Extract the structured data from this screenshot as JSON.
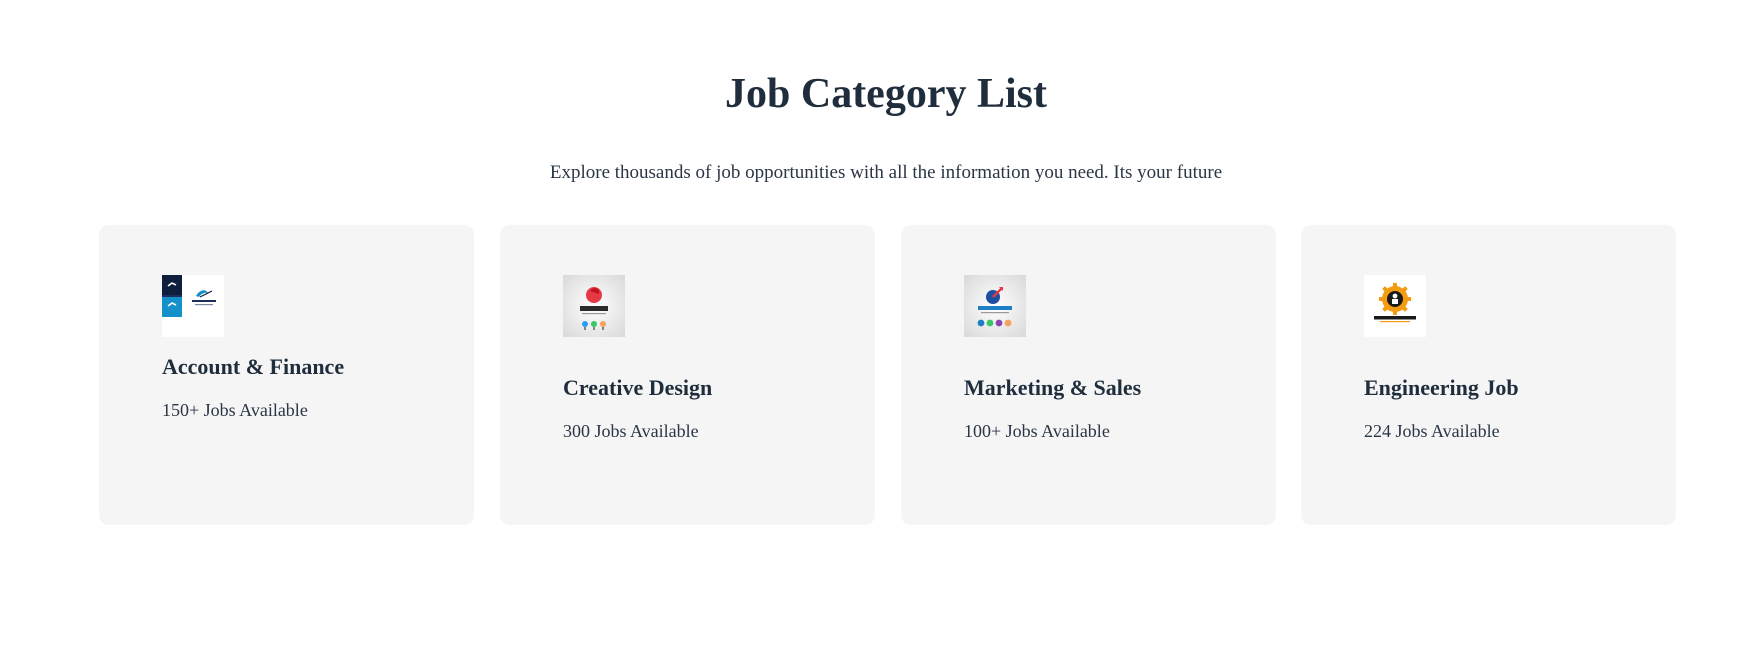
{
  "section": {
    "title": "Job Category List",
    "subtitle": "Explore thousands of job opportunities with all the information you need. Its your future"
  },
  "categories": [
    {
      "name": "Account & Finance",
      "count": "150+ Jobs Available",
      "icon": "financial-logo-icon",
      "logo_text": "FINANCIAL"
    },
    {
      "name": "Creative Design",
      "count": "300 Jobs Available",
      "icon": "unique-logo-icon",
      "logo_text": "UNIQUE"
    },
    {
      "name": "Marketing & Sales",
      "count": "100+ Jobs Available",
      "icon": "growing-up-logo-icon",
      "logo_text": "GROWINGUP"
    },
    {
      "name": "Engineering Job",
      "count": "224 Jobs Available",
      "icon": "construction-logo-icon",
      "logo_text": "CONSTRUCTION"
    }
  ],
  "colors": {
    "heading": "#1f2d3d",
    "card_background": "#f5f5f5",
    "page_background": "#ffffff"
  }
}
